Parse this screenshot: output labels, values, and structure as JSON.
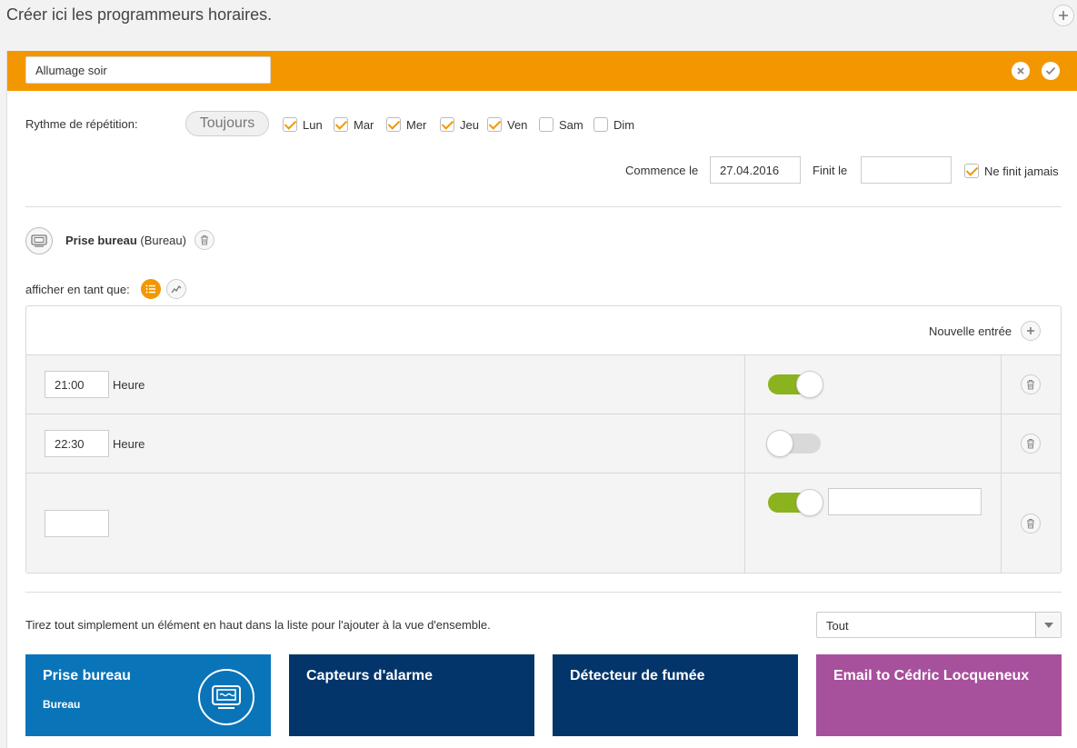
{
  "header": {
    "title": "Créer ici les programmeurs horaires."
  },
  "program": {
    "name_value": "Allumage soir",
    "name_placeholder": ""
  },
  "repeat": {
    "label": "Rythme de répétition:",
    "always_label": "Toujours",
    "days": [
      {
        "label": "Lun",
        "checked": true
      },
      {
        "label": "Mar",
        "checked": true
      },
      {
        "label": "Mer",
        "checked": true
      },
      {
        "label": "Jeu",
        "checked": true
      },
      {
        "label": "Ven",
        "checked": true
      },
      {
        "label": "Sam",
        "checked": false
      },
      {
        "label": "Dim",
        "checked": false
      }
    ]
  },
  "schedule": {
    "start_label": "Commence le",
    "start_value": "27.04.2016",
    "end_label": "Finit le",
    "end_value": "",
    "never_ends_label": "Ne finit jamais",
    "never_ends_checked": true
  },
  "device": {
    "name": "Prise bureau",
    "room": "(Bureau)"
  },
  "view": {
    "label": "afficher en tant que:"
  },
  "entries": {
    "new_entry_label": "Nouvelle entrée",
    "rows": [
      {
        "time": "21:00",
        "unit": "Heure",
        "on": true
      },
      {
        "time": "22:30",
        "unit": "Heure",
        "on": false
      },
      {
        "time": "",
        "unit": "",
        "on": true
      }
    ]
  },
  "footer": {
    "hint": "Tirez tout simplement un élément en haut dans la liste pour l'ajouter à la vue d'ensemble.",
    "filter_value": "Tout"
  },
  "tiles": [
    {
      "title": "Prise bureau",
      "subtitle": "Bureau",
      "color": "#0a74b9",
      "icon": "plug-box-icon"
    },
    {
      "title": "Capteurs d'alarme",
      "subtitle": "",
      "color": "#03356a",
      "icon": ""
    },
    {
      "title": "Détecteur de fumée",
      "subtitle": "",
      "color": "#03356a",
      "icon": ""
    },
    {
      "title": "Email to Cédric Locqueneux",
      "subtitle": "",
      "color": "#a7509c",
      "icon": ""
    }
  ],
  "colors": {
    "accent": "#f39700",
    "toggle_on": "#8bb31d",
    "toggle_off": "#d9d9d9"
  }
}
